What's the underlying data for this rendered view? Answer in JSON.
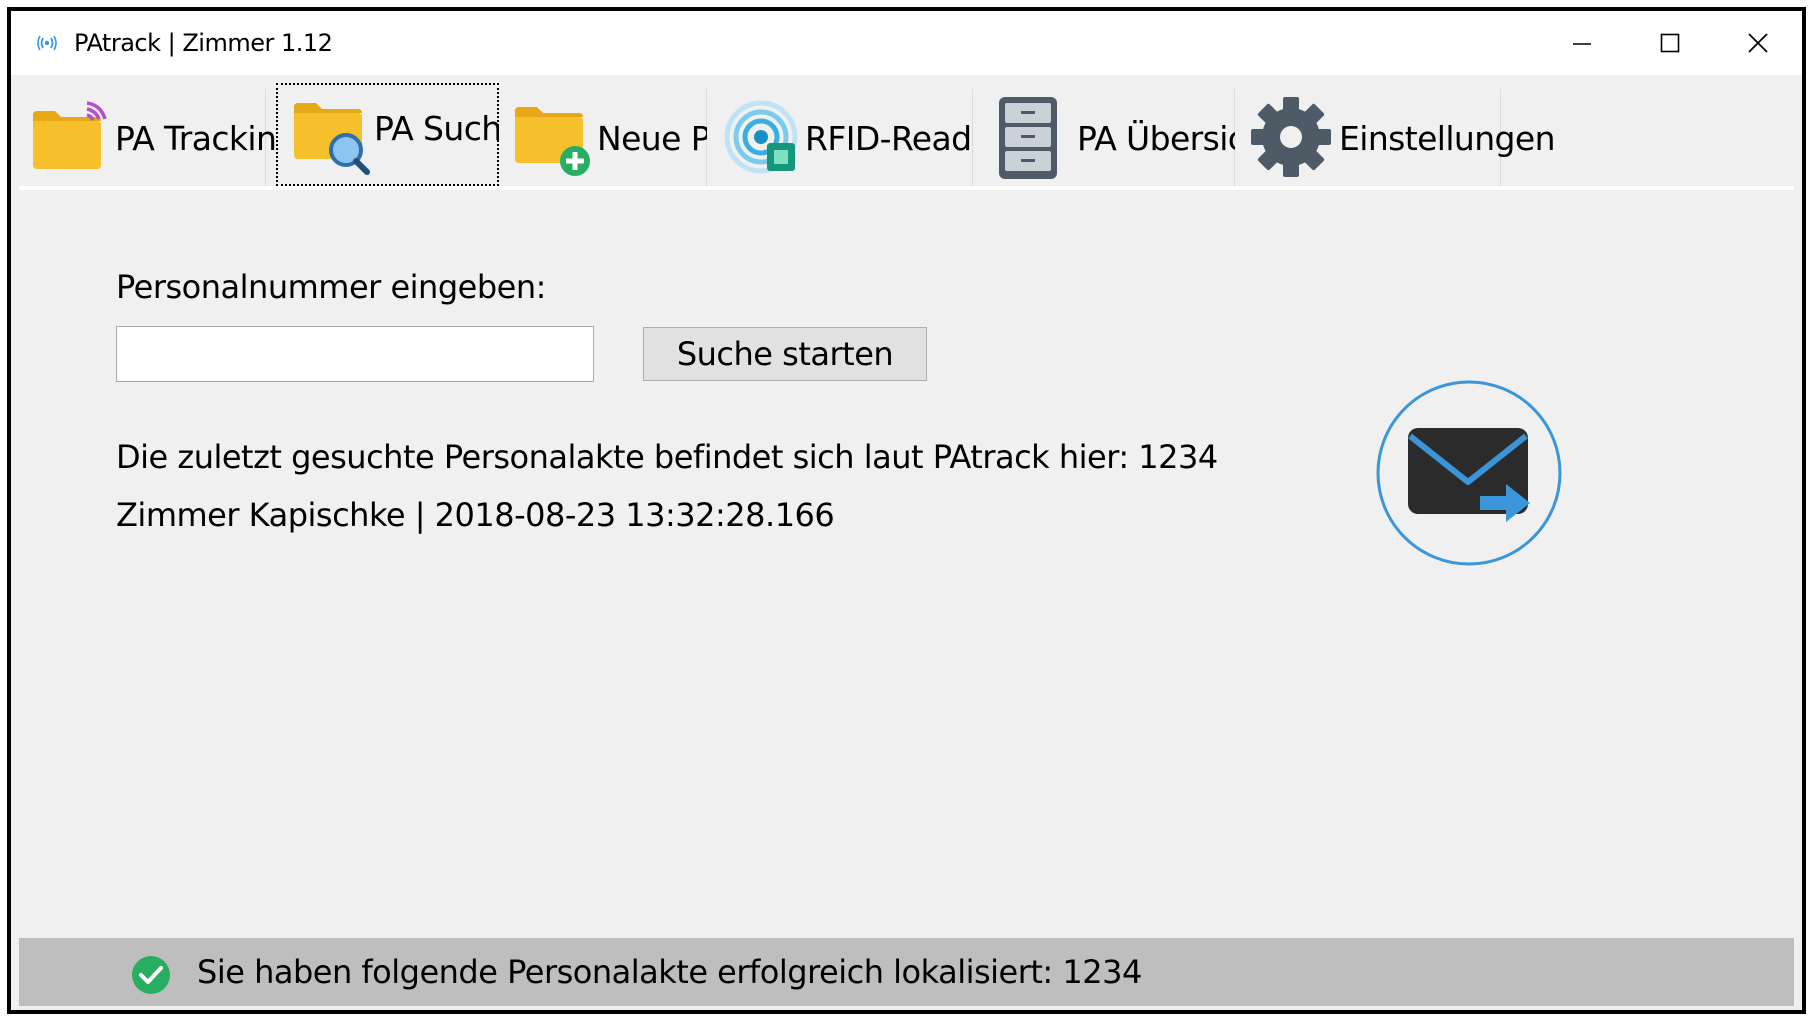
{
  "window": {
    "title": "PAtrack | Zimmer 1.12",
    "controls": {
      "minimize": "minimize-icon",
      "maximize": "maximize-icon",
      "close": "close-icon"
    }
  },
  "tabs": [
    {
      "label": "PA Tracking",
      "icon": "folder-signal-icon",
      "active": false
    },
    {
      "label": "PA Suche",
      "icon": "folder-search-icon",
      "active": true
    },
    {
      "label": "Neue PA",
      "icon": "folder-add-icon",
      "active": false
    },
    {
      "label": "RFID-Reader",
      "icon": "rfid-icon",
      "active": false
    },
    {
      "label": "PA Übersicht",
      "icon": "filing-cabinet-icon",
      "active": false
    },
    {
      "label": "Einstellungen",
      "icon": "gear-icon",
      "active": false
    }
  ],
  "search": {
    "label": "Personalnummer eingeben:",
    "input_value": "",
    "button_label": "Suche starten"
  },
  "result": {
    "line1": "Die zuletzt gesuchte Personalakte befindet sich laut PAtrack hier: 1234",
    "line2": "Zimmer Kapischke | 2018-08-23 13:32:28.166"
  },
  "actions": {
    "mail_icon": "send-mail-icon"
  },
  "status": {
    "icon": "check-circle-icon",
    "text": "Sie haben folgende Personalakte erfolgreich lokalisiert: 1234"
  },
  "colors": {
    "folder": "#f5c02b",
    "folder_dark": "#e6a817",
    "accent_blue": "#3a95d9",
    "green": "#27ae60",
    "signal_purple": "#b64fc8",
    "dark_icon": "#2b2b2b",
    "statusbar": "#bebebe"
  }
}
